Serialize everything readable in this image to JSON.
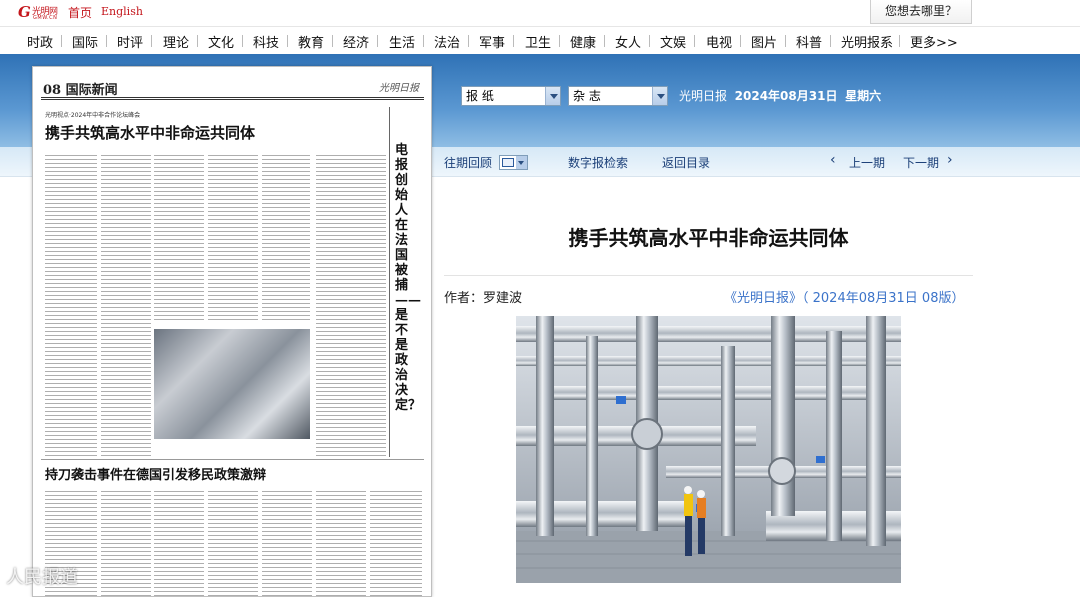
{
  "topbar": {
    "logo_text": "光明网",
    "logo_letter": "G",
    "logo_sub": "GMW.CN",
    "home_label": "首页",
    "english_label": "English",
    "whereto_label": "您想去哪里？"
  },
  "nav": {
    "items": [
      "时政",
      "国际",
      "时评",
      "理论",
      "文化",
      "科技",
      "教育",
      "经济",
      "生活",
      "法治",
      "军事",
      "卫生",
      "健康",
      "女人",
      "文娱",
      "电视",
      "图片",
      "科普",
      "光明报系",
      "更多>>"
    ]
  },
  "header": {
    "select_paper": "报  纸",
    "select_magazine": "杂  志",
    "paper_name": "光明日报",
    "date": "2024年08月31日",
    "weekday": "星期六"
  },
  "toolbar": {
    "archive_label": "往期回顾",
    "digital_search_label": "数字报检索",
    "back_to_index_label": "返回目录",
    "prev_label": "上一期",
    "next_label": "下一期"
  },
  "page_image": {
    "page_header": "08 国际新闻",
    "brand": "光明日报",
    "tag": "光明视点·2024年中非合作论坛峰会",
    "main_title": "携手共筑高水平中非命运共同体",
    "vertical_title": "电报创始人在法国被捕——是不是政治决定？",
    "second_title": "持刀袭击事件在德国引发移民政策激辩"
  },
  "article": {
    "title": "携手共筑高水平中非命运共同体",
    "author_label": "作者：",
    "author": "罗建波",
    "source": "《光明日报》（ 2024年08月31日   08版）"
  },
  "watermark": "人民报道"
}
